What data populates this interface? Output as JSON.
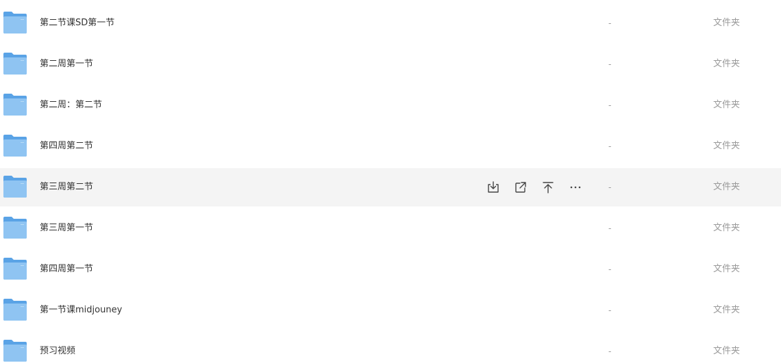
{
  "rows": [
    {
      "name": "第二节课SD第一节",
      "size": "-",
      "type": "文件夹"
    },
    {
      "name": "第二周第一节",
      "size": "-",
      "type": "文件夹"
    },
    {
      "name": "第二周：第二节",
      "size": "-",
      "type": "文件夹"
    },
    {
      "name": "第四周第二节",
      "size": "-",
      "type": "文件夹"
    },
    {
      "name": "第三周第二节",
      "size": "-",
      "type": "文件夹",
      "hovered": true
    },
    {
      "name": "第三周第一节",
      "size": "-",
      "type": "文件夹"
    },
    {
      "name": "第四周第一节",
      "size": "-",
      "type": "文件夹"
    },
    {
      "name": "第一节课midjouney",
      "size": "-",
      "type": "文件夹"
    },
    {
      "name": "预习视频",
      "size": "-",
      "type": "文件夹"
    }
  ],
  "row_actions": [
    {
      "icon": "download-icon"
    },
    {
      "icon": "share-icon"
    },
    {
      "icon": "pin-to-top-icon"
    },
    {
      "icon": "more-icon"
    }
  ],
  "colors": {
    "folder_back": "#5aa3e6",
    "folder_front": "#8fc4f2",
    "hover_bg": "#f4f4f4",
    "text": "#333333",
    "muted": "#999999"
  }
}
